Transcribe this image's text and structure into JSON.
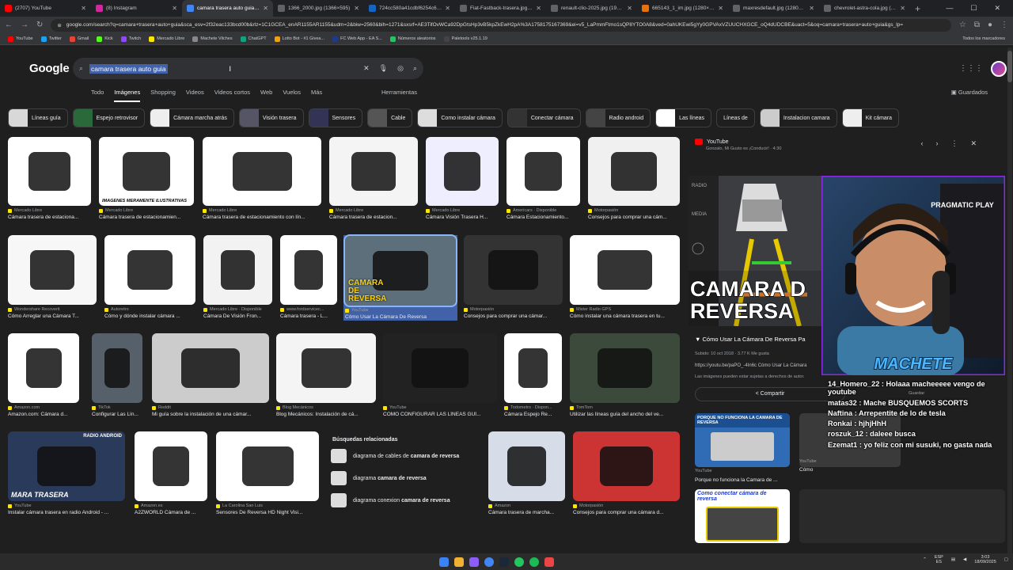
{
  "tabs": [
    {
      "title": "(2707) YouTube",
      "color": "#ff0000"
    },
    {
      "title": "(8) Instagram",
      "color": "#d6249f"
    },
    {
      "title": "camara trasera auto guia - Bu",
      "color": "#4285f4",
      "active": true
    },
    {
      "title": "1366_2000.jpg (1366×595)",
      "color": "#5f6368"
    },
    {
      "title": "724cc580a41cdbf6254c66fcc",
      "color": "#1565c0"
    },
    {
      "title": "Fiat-Fastback-trasera.jpg (12",
      "color": "#5f6368"
    },
    {
      "title": "renault-clio-2025.jpg (1920×",
      "color": "#5f6368"
    },
    {
      "title": "665143_1_im.jpg (1280×1051)",
      "color": "#e8710a"
    },
    {
      "title": "maxresdefault.jpg (1280×720)",
      "color": "#5f6368"
    },
    {
      "title": "chevrolet-astra-cola.jpg (120",
      "color": "#5f6368"
    }
  ],
  "address": {
    "url": "google.com/search?q=camara+trasera+auto+guia&sca_esv=2f32eac133bcd00b&rlz=1C1GCEA_enAR1155AR1155&udm=2&biw=2560&bih=1271&sxsrf=AE3TifOvWCa92DpGtsHp3vB5kpZkEwH2pA%3A1758175167369&ei=v5_LaPmmFtmo1sQP8YTO0A8&ved=0ahUKEwi5gYy0GPVAxVZUUCHXGCE_oQ4dUDCBE&uact=5&oq=camara+trasera+auto+guia&gs_lp="
  },
  "bookmarks": [
    "YouTube",
    "Twitter",
    "Gmail",
    "Kick",
    "Twitch",
    "Mercado Libre",
    "Machete Vilches",
    "ChatGPT",
    "Lotto Bot - #1 Givea...",
    "FC Web App - EA S...",
    "Números aleatorios",
    "Paletools v25.1.19"
  ],
  "bookmarks_right": "Todos los marcadores",
  "google": {
    "logo": "Google",
    "query": "camara trasera auto guia",
    "tabs": [
      "Todo",
      "Imágenes",
      "Shopping",
      "Videos",
      "Videos cortos",
      "Web",
      "Vuelos",
      "Más"
    ],
    "tools": "Herramientas",
    "saved": "Guardados"
  },
  "chips": [
    "Líneas guía",
    "Espejo retrovisor",
    "Cámara marcha atrás",
    "Visión trasera",
    "Sensores",
    "Cable",
    "Como instalar cámara",
    "Conectar cámara",
    "Radio android",
    "Las líneas",
    "Líneas de",
    "Instalacion camara",
    "Kit cámara"
  ],
  "results": [
    {
      "src": "Mercado Libre",
      "title": "Cámara trasera de estaciona..."
    },
    {
      "src": "Mercado Libre",
      "title": "Cámara trasera de estacionamien..."
    },
    {
      "src": "Mercado Libre",
      "title": "Cámara trasera de estacionamiento con lín..."
    },
    {
      "src": "Mercado Libre",
      "title": "Cámara trasera de estacion..."
    },
    {
      "src": "Mercado Libre",
      "title": "Cámara Visión Trasera H..."
    },
    {
      "src": "Americars · Disponible",
      "title": "Cámara Estacionamiento..."
    },
    {
      "src": "Motorpasión",
      "title": "Consejos para comprar una cám..."
    },
    {
      "src": "Wondershare Recoverit",
      "title": "Cómo Arreglar una Cámara T..."
    },
    {
      "src": "Autoretro",
      "title": "Cómo y dónde instalar cámara ..."
    },
    {
      "src": "Mercado Libre · Disponible",
      "title": "Cámara De Visión Fron..."
    },
    {
      "src": "www.fordservicec...",
      "title": "Cámara trasera - L..."
    },
    {
      "src": "YouTube",
      "title": "Cómo Usar La Cámara De Reversa"
    },
    {
      "src": "Motorpasión",
      "title": "Consejos para comprar una cámar..."
    },
    {
      "src": "Mister Radio GPS",
      "title": "Cómo instalar una cámara trasera en tu..."
    },
    {
      "src": "Amazon.com",
      "title": "Amazon.com: Cámara d..."
    },
    {
      "src": "TikTok",
      "title": "Configurar Las Lín..."
    },
    {
      "src": "Reddit",
      "title": "Mi guía sobre la instalación de una cámar..."
    },
    {
      "src": "Blog Mecánicos",
      "title": "Blog Mecánicos: Instalación de cá..."
    },
    {
      "src": "YouTube",
      "title": "COMO CONFIGURAR LAS LÍNEAS GUÍ..."
    },
    {
      "src": "Todometro · Dispon...",
      "title": "Cámara Espejo Re..."
    },
    {
      "src": "TomTom",
      "title": "Utilizar las líneas guía del ancho del ve..."
    },
    {
      "src": "YouTube",
      "title": "Instalar cámara trasera en radio Android - ..."
    },
    {
      "src": "Amazon.es",
      "title": "A2ZWORLD Cámara de ..."
    },
    {
      "src": "La Carolina San Luis",
      "title": "Sensores De Reversa HD Night Visi..."
    },
    {
      "src": "Amazon",
      "title": "Cámara trasera de marcha..."
    },
    {
      "src": "Motorpasión",
      "title": "Consejos para comprar una cámara d..."
    }
  ],
  "related": {
    "heading": "Búsquedas relacionadas",
    "items": [
      {
        "pre": "diagrama de cables de ",
        "post": "camara de reversa"
      },
      {
        "pre": "diagrama ",
        "post": "camara de reversa"
      },
      {
        "pre": "diagrama conexion ",
        "post": "camara de reversa"
      }
    ]
  },
  "overlay_texts": {
    "img_a": "IMAGENES MERAMENTE ILUSTRATIVAS",
    "img_b": "CAMARA DE REVERSA",
    "img_c": "MARA TRASERA",
    "img_c2": "RADIO ANDROID"
  },
  "panel": {
    "source": "YouTube",
    "subtitle": "Gonzalo, Mi Gusto es ¡Conducir! · 4:30",
    "title": "Cómo Usar La Cámara De Reversa Pa",
    "meta": "Subido: 10 oct 2018 · 3.77 K Me gusta",
    "url": "https://youtu.be/paPO_-4In6c Cómo Usar La Cámara",
    "note": "Las imágenes pueden estar sujetas a derechos de autor.",
    "share": "Compartir",
    "save": "Guardar",
    "img_text": "CAMARA D REVERSA",
    "labels": [
      "RADIO",
      "MEDIA"
    ],
    "rel1_title": "Porque no funciona la Camara de ...",
    "rel1_src": "YouTube",
    "rel2_text": "Como conectar cámara de reversa",
    "rel1_overlay": "PORQUE NO FUNCIONA LA CAMARA DE REVERSA",
    "rel3_src": "YouTube",
    "rel3_title": "Cómo"
  },
  "stream": {
    "brand": "MACHETE",
    "sponsor": "PRAGMATIC PLAY"
  },
  "chat": [
    {
      "user": "14_Homero_22",
      "msg": "Holaaa macheeeee vengo de youtube"
    },
    {
      "user": "matas32",
      "msg": "Mache BUSQUEMOS SCORTS"
    },
    {
      "user": "Naftina",
      "msg": "Arrepentite de lo de tesla"
    },
    {
      "user": "Ronkai",
      "msg": "hjhjHhH"
    },
    {
      "user": "roszuk_12",
      "msg": "daleee busca"
    },
    {
      "user": "Ezemat1",
      "msg": "yo feliz con mi susuki, no gasta nada"
    }
  ],
  "tray": {
    "lang": "ESP",
    "lang2": "ES",
    "time": "3:03",
    "date": "18/09/2025"
  }
}
